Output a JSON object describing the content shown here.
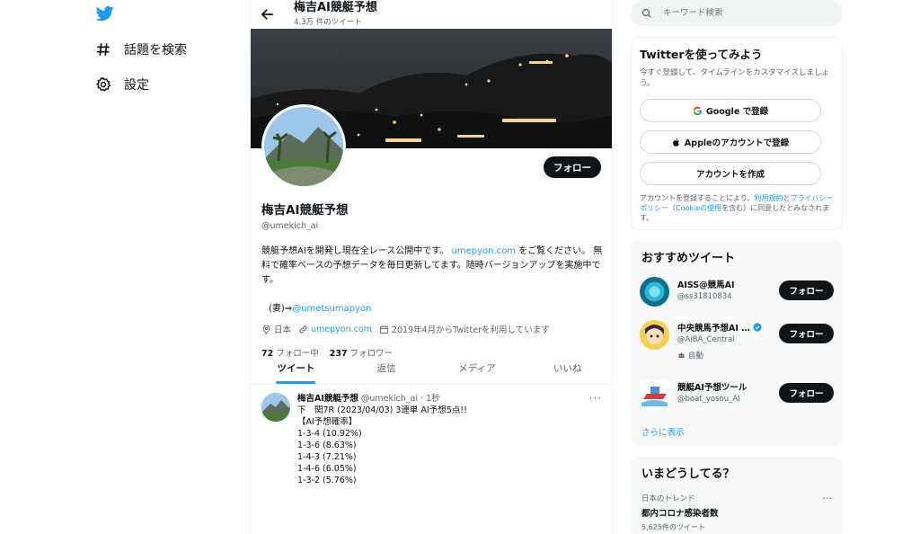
{
  "nav": {
    "explore_label": "話題を検索",
    "settings_label": "設定"
  },
  "header": {
    "title": "梅吉AI競艇予想",
    "tweet_count": "4.3万 件のツイート"
  },
  "profile": {
    "name": "梅吉AI競艇予想",
    "handle": "@umekich_ai",
    "follow_label": "フォロー",
    "bio_part1": "競艇予想AIを開発し現在全レース公開中です。",
    "bio_link": "umepyon.com",
    "bio_part2": " をご覧ください。 無料で確率ベースの予想データを毎日更新してます。随時バージョンアップを実施中です。",
    "bio_sub_prefix": "(妻)⇒",
    "bio_sub_link": "@umetsumapyon",
    "location": "日本",
    "website": "umepyon.com",
    "joined": "2019年4月からTwitterを利用しています",
    "following_count": "72",
    "following_label": "フォロー中",
    "followers_count": "237",
    "followers_label": "フォロワー"
  },
  "tabs": [
    {
      "label": "ツイート"
    },
    {
      "label": "返信"
    },
    {
      "label": "メディア"
    },
    {
      "label": "いいね"
    }
  ],
  "tweet": {
    "name": "梅吉AI競艇予想",
    "handle_time": "@umekich_ai · 1秒",
    "more": "···",
    "lines": [
      "下　関7R (2023/04/03) 3連単 AI予想5点!!",
      "",
      "【AI予想確率】",
      "",
      "1-3-4 (10.92%)",
      "1-3-6 (8.63%)",
      "1-4-3 (7.21%)",
      "1-4-6 (6.05%)",
      "1-3-2 (5.76%)"
    ]
  },
  "search": {
    "placeholder": "キーワード検索"
  },
  "signup_card": {
    "title": "Twitterを使ってみよう",
    "desc": "今すぐ登録して、タイムラインをカスタマイズしましょう。",
    "google_label": "Google で登録",
    "apple_label": "Appleのアカウントで登録",
    "create_label": "アカウントを作成",
    "legal_part1": "アカウントを登録することにより、",
    "legal_terms": "利用規約",
    "legal_and": "と",
    "legal_privacy": "プライバシーポリシー",
    "legal_part2": "（",
    "legal_cookie": "Cookieの使用",
    "legal_part3": "を含む）に同意したとみなされます。"
  },
  "recommend": {
    "title": "おすすめツイート",
    "follow_label": "フォロー",
    "more_label": "さらに表示",
    "users": [
      {
        "name": "AISS@競馬AI",
        "handle": "@ss31810834"
      },
      {
        "name": "中央競馬予想AI …",
        "handle": "@AiBA_Central",
        "badge": "自動"
      },
      {
        "name": "競艇AI予想ツール",
        "handle": "@boat_yosou_AI"
      }
    ]
  },
  "trends": {
    "title": "いまどうしてる？",
    "category": "日本のトレンド",
    "topic": "都内コロナ感染者数",
    "count": "5,625件のツイート",
    "more": "···"
  },
  "colors": {
    "accent": "#1d9bf0",
    "text": "#0f1419",
    "muted": "#536471"
  }
}
